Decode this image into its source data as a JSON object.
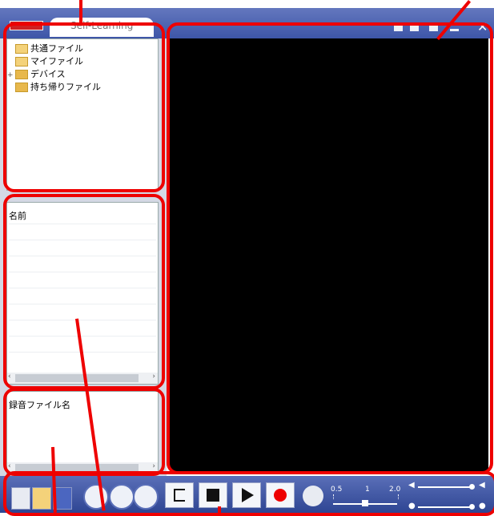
{
  "window": {
    "title": "Self-Learning"
  },
  "folder_tree": {
    "items": [
      {
        "label": "共通ファイル",
        "icon": "folder-icon",
        "expandable": false
      },
      {
        "label": "マイファイル",
        "icon": "folder-icon",
        "expandable": false
      },
      {
        "label": "デバイス",
        "icon": "device-folder-icon",
        "expandable": true,
        "expand_symbol": "+"
      },
      {
        "label": "持ち帰りファイル",
        "icon": "takehome-folder-icon",
        "expandable": false
      }
    ]
  },
  "name_list": {
    "header": "名前"
  },
  "recording_list": {
    "header": "録音ファイル名"
  },
  "speed": {
    "labels": [
      "0.5",
      "1",
      "2.0"
    ],
    "value": 1
  },
  "colors": {
    "accent_bar": "#3e56a8",
    "annotation_red": "#e00000",
    "video_bg": "#000000"
  }
}
